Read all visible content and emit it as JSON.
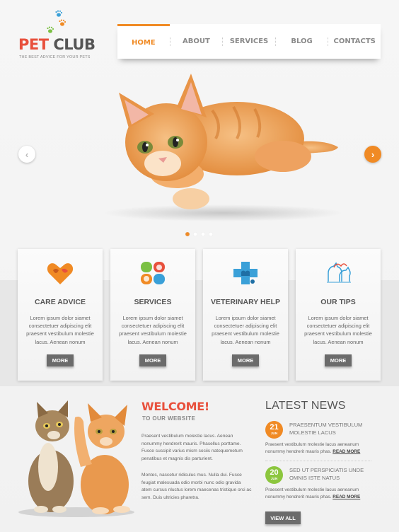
{
  "brand": {
    "logo_part1": "PET",
    "logo_part2": "CLUB",
    "tagline": "THE BEST ADVICE FOR YOUR PETS",
    "colors": {
      "accent": "#f08a24",
      "red": "#e8503c",
      "paw_blue": "#3aa0d8",
      "paw_green": "#7bc043"
    }
  },
  "nav": {
    "items": [
      {
        "label": "HOME",
        "active": true
      },
      {
        "label": "ABOUT"
      },
      {
        "label": "SERVICES"
      },
      {
        "label": "BLOG"
      },
      {
        "label": "CONTACTS"
      }
    ]
  },
  "slider": {
    "prev_icon": "chevron-left-icon",
    "next_icon": "chevron-right-icon",
    "prev_glyph": "‹",
    "next_glyph": "›",
    "slide_count": 4,
    "active_slide": 1
  },
  "features": [
    {
      "icon": "heart-pets-icon",
      "title": "CARE ADVICE",
      "text": "Lorem ipsum dolor siamet consectetuer adipiscing elit praesent vestibulum molestie lacus. Aenean nonum",
      "button": "MORE"
    },
    {
      "icon": "pets-grid-icon",
      "title": "SERVICES",
      "text": "Lorem ipsum dolor siamet consectetuer adipiscing elit praesent vestibulum molestie lacus. Aenean nonum",
      "button": "MORE"
    },
    {
      "icon": "veterinary-cross-icon",
      "title": "VETERINARY HELP",
      "text": "Lorem ipsum dolor siamet consectetuer adipiscing elit praesent vestibulum molestie lacus. Aenean nonum",
      "button": "MORE"
    },
    {
      "icon": "cat-dog-outline-icon",
      "title": "OUR TIPS",
      "text": "Lorem ipsum dolor siamet consectetuer adipiscing elit praesent vestibulum molestie lacus. Aenean nonum",
      "button": "MORE"
    }
  ],
  "welcome": {
    "title": "WELCOME!",
    "subtitle": "TO OUR WEBSITE",
    "paragraphs": [
      "Praesent vestibulum molestie lacus. Aenean nonummy hendrerit mauris. Phasellus porttame. Fusce suscipit varius mism sociis natoquemetum penatibus et magnis dis parturient.",
      "Montes, nascetur ridiculus mus. Nulla dui. Fusce feugiat malesuada odio morbi nunc odio gravida atem cursus nluctus lorem maecenas tristique orci ac sem. Duis ultricies pharetra."
    ]
  },
  "news": {
    "title": "LATEST NEWS",
    "items": [
      {
        "day": "21",
        "month": "JUN",
        "color": "#f08a24",
        "headline": "PRAESENTUM VESTIBULUM MOLESTIE LACUS",
        "body": "Praesent vestibulum molestie lacus aeneanum nonummy hendrerit mauris phas.",
        "read_more": "READ MORE"
      },
      {
        "day": "20",
        "month": "JUN",
        "color": "#8cc63e",
        "headline": "SED UT PERSPICIATIS UNDE OMNIS ISTE NATUS",
        "body": "Praesent vestibulum molestie lacus aeneanum nonummy hendrerit mauris phas.",
        "read_more": "READ MORE"
      }
    ],
    "view_all": "VIEW ALL"
  }
}
